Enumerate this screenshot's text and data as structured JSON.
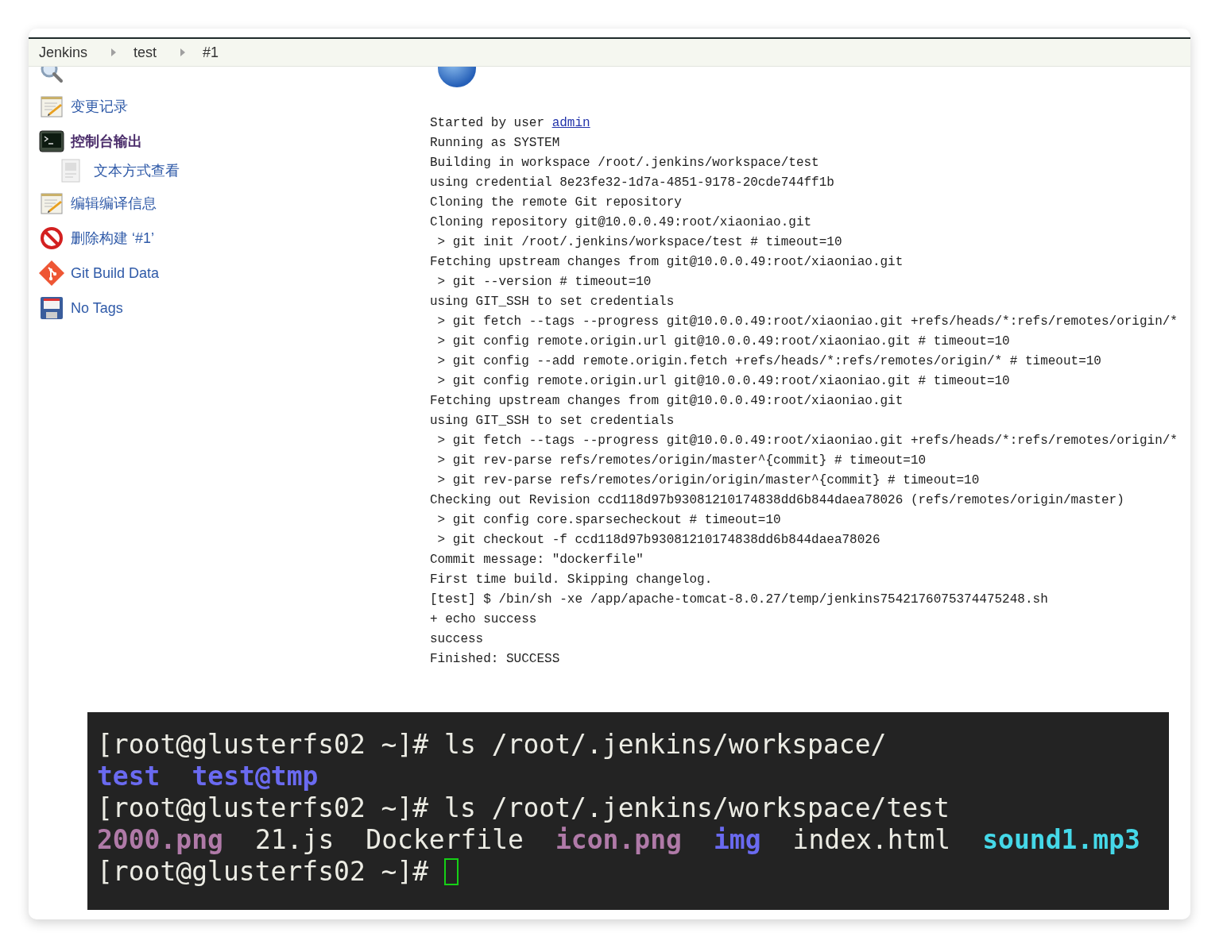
{
  "breadcrumbs": [
    {
      "label": "Jenkins"
    },
    {
      "label": "test"
    },
    {
      "label": "#1"
    }
  ],
  "sidebar": {
    "items": [
      {
        "kind": "search"
      },
      {
        "label": "变更记录",
        "kind": "notepad",
        "selected": false
      },
      {
        "label": "控制台输出",
        "kind": "terminal",
        "selected": true,
        "children": [
          {
            "label": "文本方式查看",
            "kind": "document",
            "selected": false
          }
        ]
      },
      {
        "label": "编辑编译信息",
        "kind": "notepad",
        "selected": false
      },
      {
        "label": "删除构建 ‘#1’",
        "kind": "prohibit",
        "selected": false
      },
      {
        "label": "Git Build Data",
        "kind": "git",
        "selected": false
      },
      {
        "label": "No Tags",
        "kind": "floppy",
        "selected": false
      }
    ]
  },
  "console": {
    "lines": [
      {
        "text": "Started by user ",
        "link": "admin"
      },
      {
        "text": "Running as SYSTEM"
      },
      {
        "text": "Building in workspace /root/.jenkins/workspace/test"
      },
      {
        "text": "using credential 8e23fe32-1d7a-4851-9178-20cde744ff1b"
      },
      {
        "text": "Cloning the remote Git repository"
      },
      {
        "text": "Cloning repository git@10.0.0.49:root/xiaoniao.git"
      },
      {
        "text": " > git init /root/.jenkins/workspace/test # timeout=10"
      },
      {
        "text": "Fetching upstream changes from git@10.0.0.49:root/xiaoniao.git"
      },
      {
        "text": " > git --version # timeout=10"
      },
      {
        "text": "using GIT_SSH to set credentials"
      },
      {
        "text": " > git fetch --tags --progress git@10.0.0.49:root/xiaoniao.git +refs/heads/*:refs/remotes/origin/*"
      },
      {
        "text": " > git config remote.origin.url git@10.0.0.49:root/xiaoniao.git # timeout=10"
      },
      {
        "text": " > git config --add remote.origin.fetch +refs/heads/*:refs/remotes/origin/* # timeout=10"
      },
      {
        "text": " > git config remote.origin.url git@10.0.0.49:root/xiaoniao.git # timeout=10"
      },
      {
        "text": "Fetching upstream changes from git@10.0.0.49:root/xiaoniao.git"
      },
      {
        "text": "using GIT_SSH to set credentials"
      },
      {
        "text": " > git fetch --tags --progress git@10.0.0.49:root/xiaoniao.git +refs/heads/*:refs/remotes/origin/*"
      },
      {
        "text": " > git rev-parse refs/remotes/origin/master^{commit} # timeout=10"
      },
      {
        "text": " > git rev-parse refs/remotes/origin/origin/master^{commit} # timeout=10"
      },
      {
        "text": "Checking out Revision ccd118d97b93081210174838dd6b844daea78026 (refs/remotes/origin/master)"
      },
      {
        "text": " > git config core.sparsecheckout # timeout=10"
      },
      {
        "text": " > git checkout -f ccd118d97b93081210174838dd6b844daea78026"
      },
      {
        "text": "Commit message: \"dockerfile\""
      },
      {
        "text": "First time build. Skipping changelog."
      },
      {
        "text": "[test] $ /bin/sh -xe /app/apache-tomcat-8.0.27/temp/jenkins7542176075374475248.sh"
      },
      {
        "text": "+ echo success"
      },
      {
        "text": "success"
      },
      {
        "text": "Finished: SUCCESS"
      }
    ]
  },
  "terminal": {
    "lines": [
      {
        "parts": [
          {
            "text": "[root@glusterfs02 ~]# ls /root/.jenkins/workspace/",
            "kind": "plain"
          }
        ]
      },
      {
        "parts": [
          {
            "text": "test",
            "kind": "dir"
          },
          {
            "text": "test@tmp",
            "kind": "dir"
          }
        ]
      },
      {
        "parts": [
          {
            "text": "[root@glusterfs02 ~]# ls /root/.jenkins/workspace/test",
            "kind": "plain"
          }
        ]
      },
      {
        "parts": [
          {
            "text": "2000.png",
            "kind": "image"
          },
          {
            "text": "21.js",
            "kind": "plain"
          },
          {
            "text": "Dockerfile",
            "kind": "plain"
          },
          {
            "text": "icon.png",
            "kind": "image"
          },
          {
            "text": "img",
            "kind": "dir"
          },
          {
            "text": "index.html",
            "kind": "plain"
          },
          {
            "text": "sound1.mp3",
            "kind": "audio"
          }
        ]
      },
      {
        "parts": [
          {
            "text": "[root@glusterfs02 ~]#",
            "kind": "plain"
          }
        ],
        "cursor": true
      }
    ]
  }
}
